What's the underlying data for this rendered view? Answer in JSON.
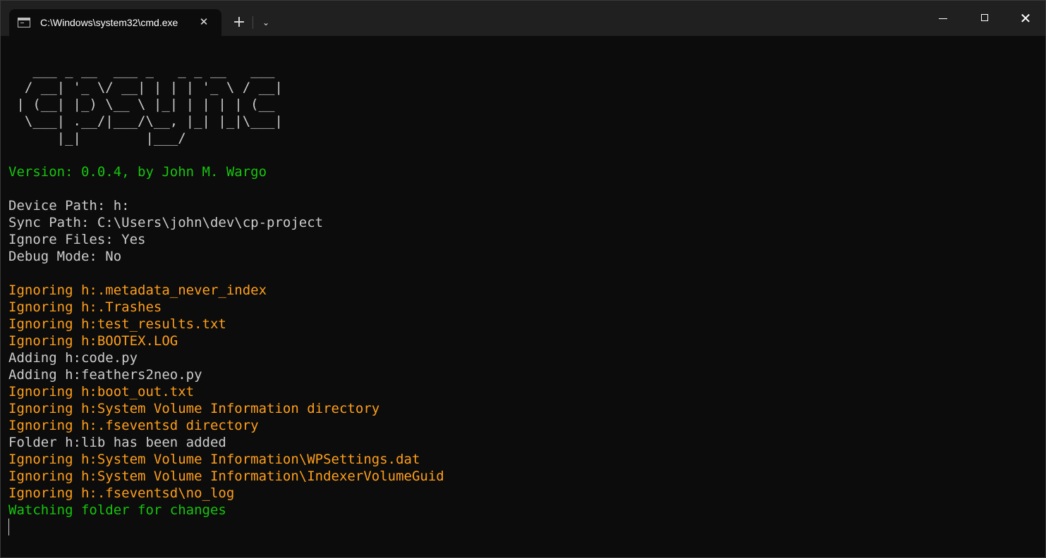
{
  "tab": {
    "title": "C:\\Windows\\system32\\cmd.exe",
    "icon": "terminal-icon",
    "close_glyph": "✕"
  },
  "toolbar": {
    "new_tab_glyph": "+",
    "dropdown_glyph": "⌄"
  },
  "window_controls": {
    "close_glyph": "✕"
  },
  "console": {
    "banner": [
      "   ___ _ __  ___ _   _ _ __   ___",
      "  / __| '_ \\/ __| | | | '_ \\ / __|",
      " | (__| |_) \\__ \\ |_| | | | | (__",
      "  \\___| .__/|___/\\__, |_| |_|\\___|",
      "      |_|        |___/"
    ],
    "version_line": "Version: 0.0.4, by John M. Wargo",
    "config": [
      "Device Path: h:",
      "Sync Path: C:\\Users\\john\\dev\\cp-project",
      "Ignore Files: Yes",
      "Debug Mode: No"
    ],
    "log": [
      {
        "text": "Ignoring h:.metadata_never_index",
        "level": "ignore"
      },
      {
        "text": "Ignoring h:.Trashes",
        "level": "ignore"
      },
      {
        "text": "Ignoring h:test_results.txt",
        "level": "ignore"
      },
      {
        "text": "Ignoring h:BOOTEX.LOG",
        "level": "ignore"
      },
      {
        "text": "Adding h:code.py",
        "level": "info"
      },
      {
        "text": "Adding h:feathers2neo.py",
        "level": "info"
      },
      {
        "text": "Ignoring h:boot_out.txt",
        "level": "ignore"
      },
      {
        "text": "Ignoring h:System Volume Information directory",
        "level": "ignore"
      },
      {
        "text": "Ignoring h:.fseventsd directory",
        "level": "ignore"
      },
      {
        "text": "Folder h:lib has been added",
        "level": "info"
      },
      {
        "text": "Ignoring h:System Volume Information\\WPSettings.dat",
        "level": "ignore"
      },
      {
        "text": "Ignoring h:System Volume Information\\IndexerVolumeGuid",
        "level": "ignore"
      },
      {
        "text": "Ignoring h:.fseventsd\\no_log",
        "level": "ignore"
      },
      {
        "text": "Watching folder for changes",
        "level": "status"
      }
    ]
  },
  "colors": {
    "background": "#0c0c0c",
    "titlebar": "#202020",
    "text": "#cccccc",
    "green": "#16c60c",
    "orange": "#ff9f1a"
  }
}
